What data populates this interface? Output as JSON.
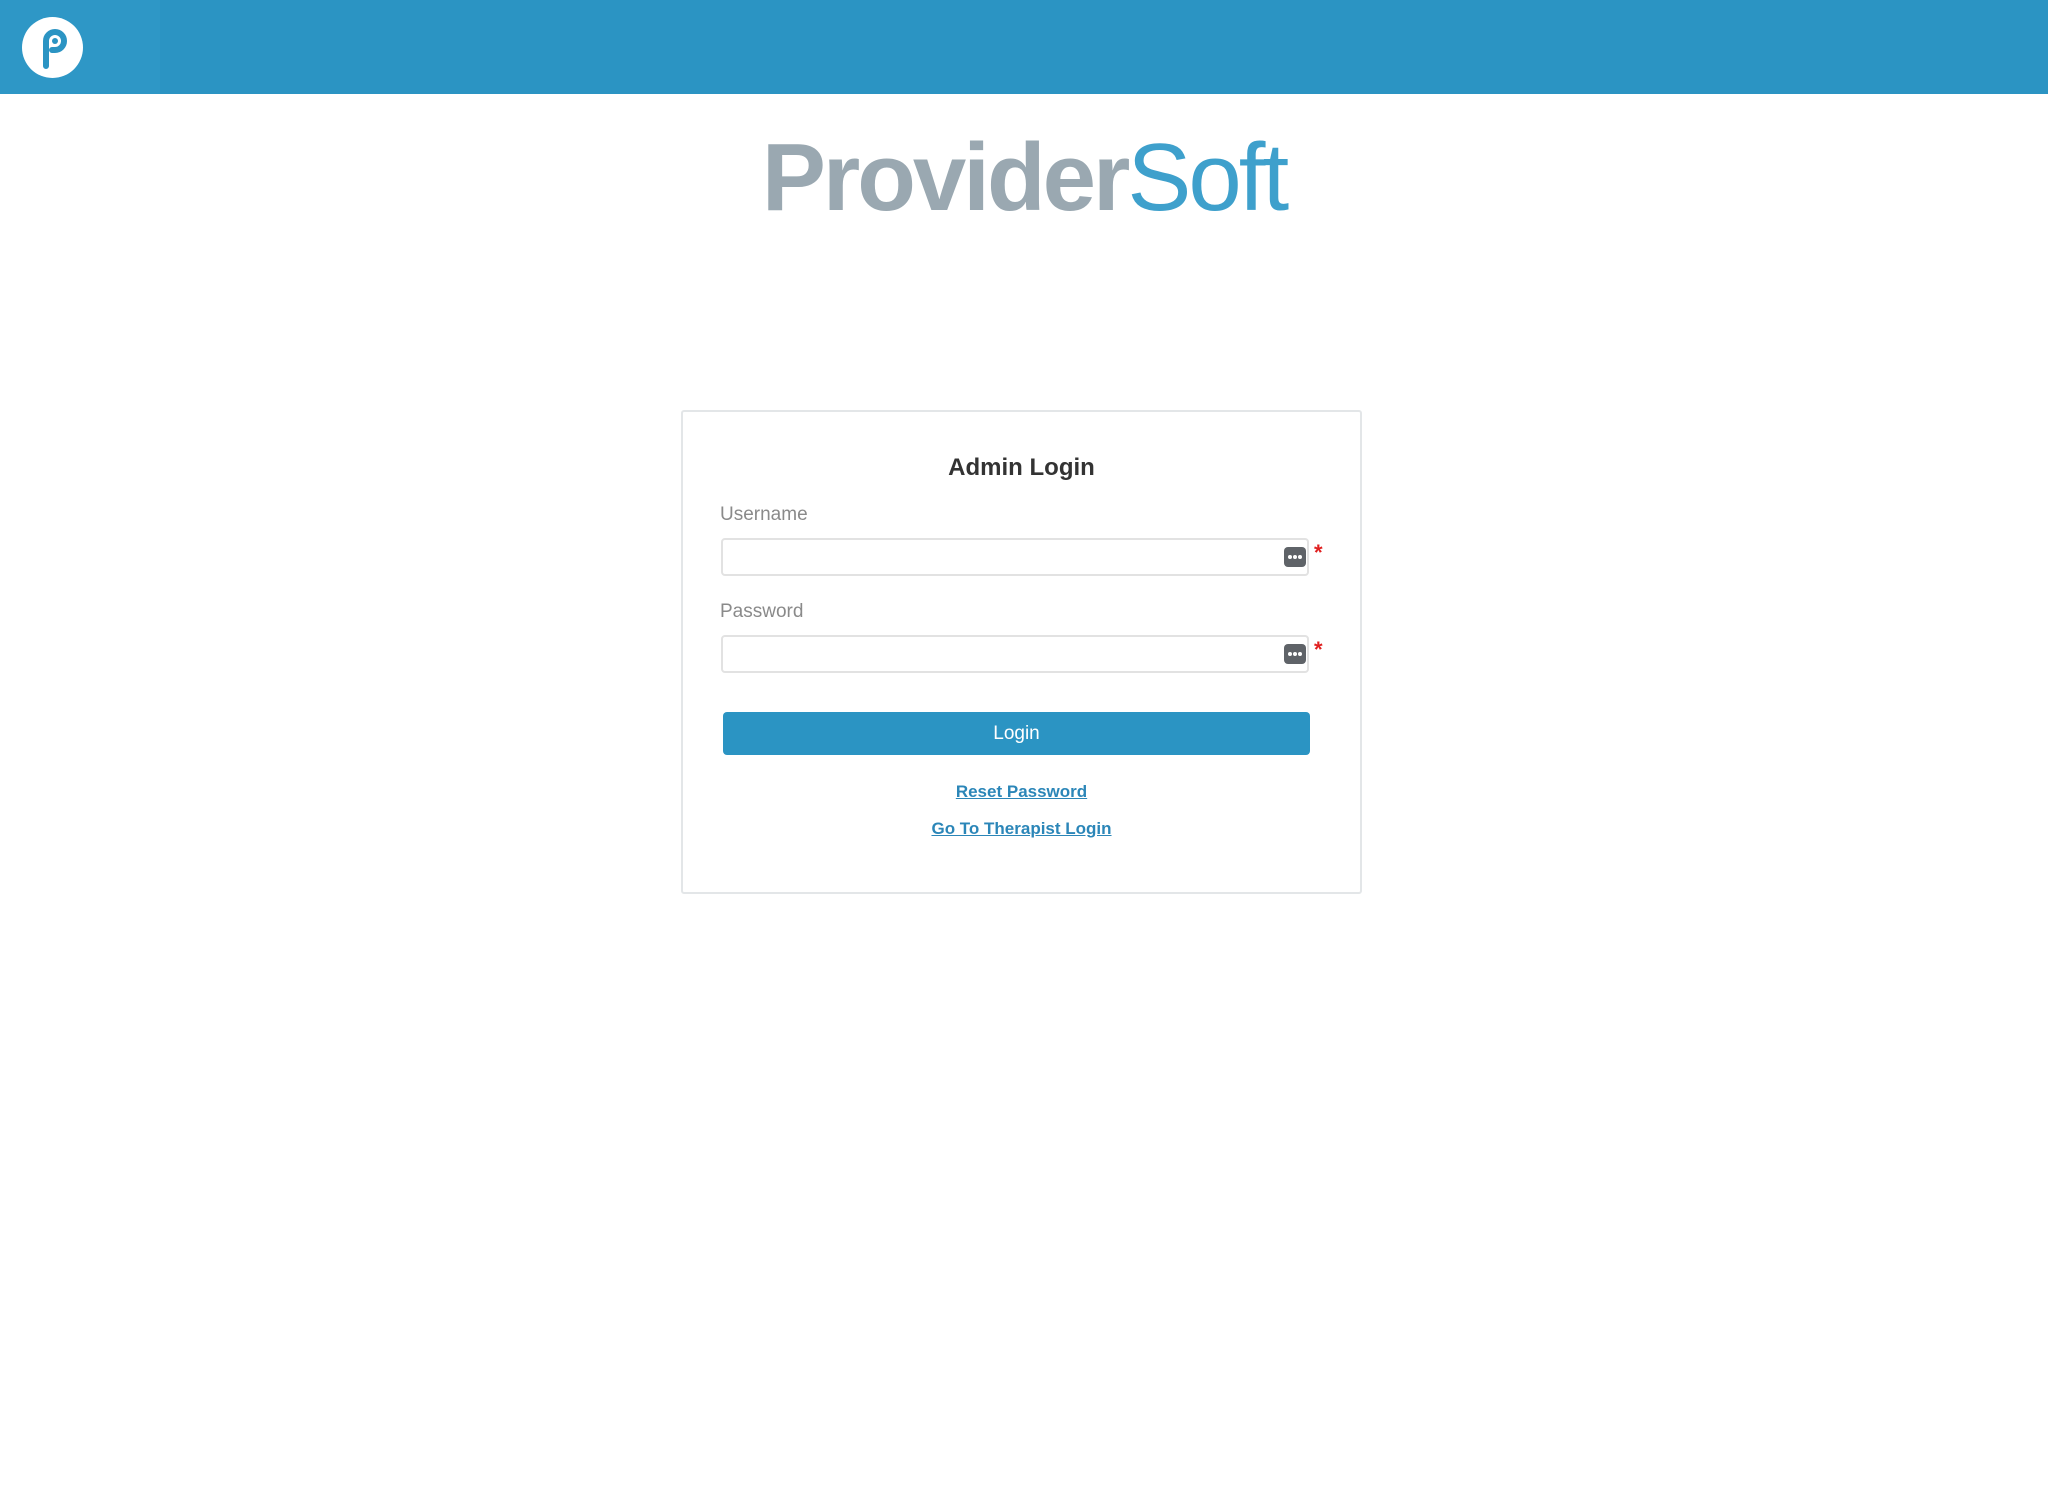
{
  "topbar": {
    "logo_icon": "providersoft-p-icon",
    "accent_color": "#2b94c3"
  },
  "brand": {
    "part1": "Provider",
    "part2": "Soft"
  },
  "login_card": {
    "title": "Admin Login",
    "username_label": "Username",
    "username_value": "",
    "password_label": "Password",
    "password_value": "",
    "required_mark": "*",
    "login_label": "Login",
    "reset_password_label": "Reset Password",
    "therapist_login_label": "Go To Therapist Login",
    "field_icon": "password-manager-key-icon"
  }
}
